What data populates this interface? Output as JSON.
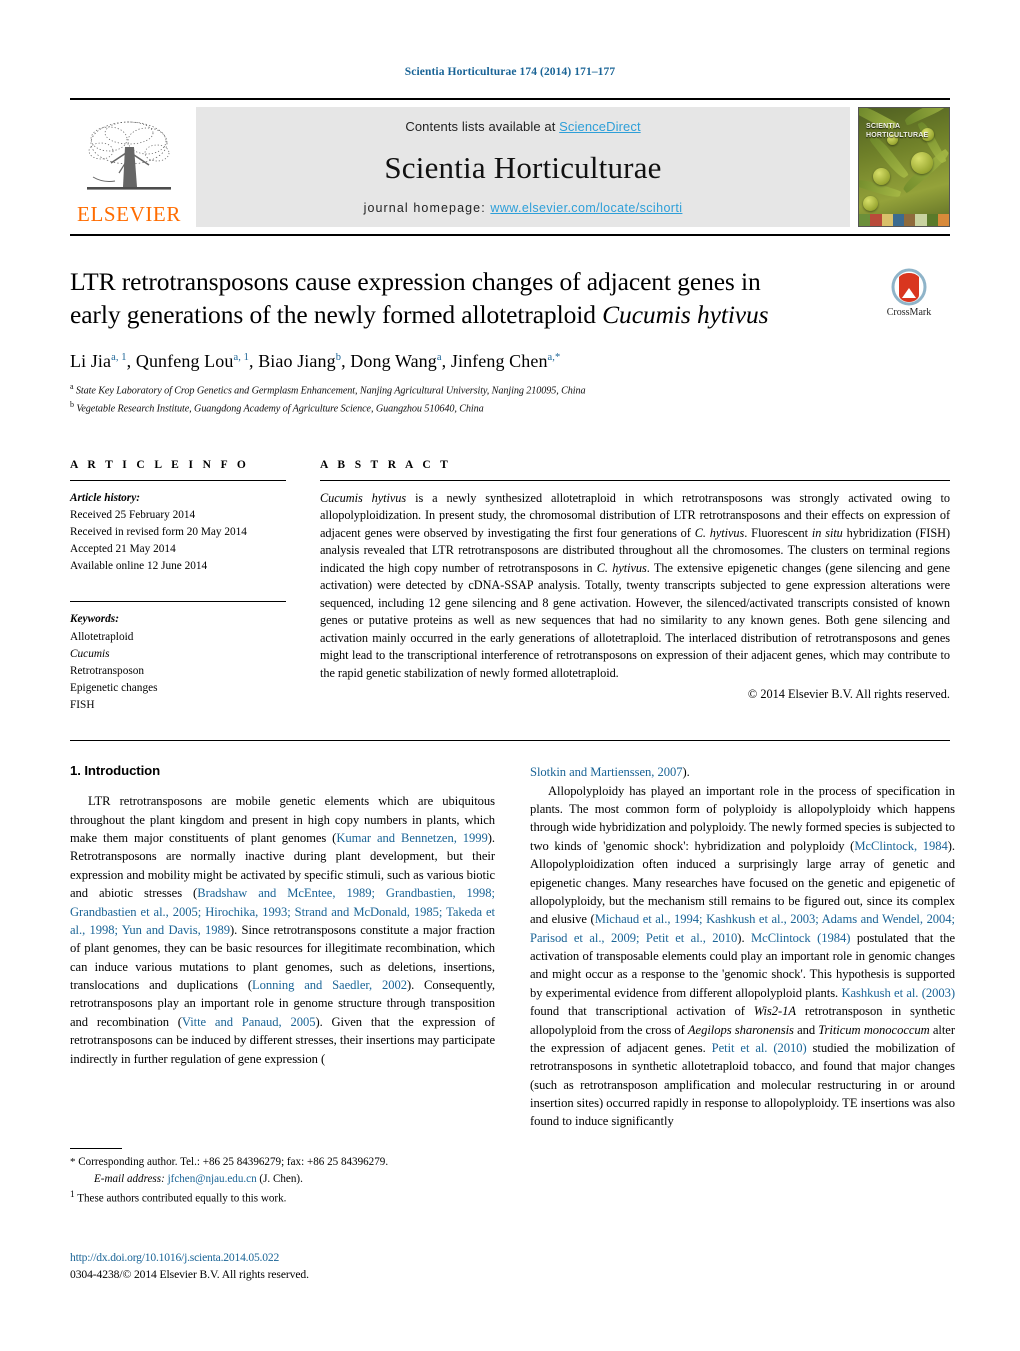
{
  "running_head": "Scientia Horticulturae 174 (2014) 171–177",
  "masthead": {
    "contents_prefix": "Contents lists available at ",
    "contents_link": "ScienceDirect",
    "journal_title": "Scientia Horticulturae",
    "homepage_prefix": "journal homepage: ",
    "homepage_url": "www.elsevier.com/locate/scihorti",
    "publisher_wordmark": "ELSEVIER",
    "publisher_logo_icon": "elsevier-tree-icon",
    "cover_title_line1": "SCIENTIA",
    "cover_title_line2": "HORTICULTURAE",
    "accent_link_color": "#2e9fd8",
    "publisher_orange": "#ff6c00"
  },
  "title_block": {
    "title_line1": "LTR retrotransposons cause expression changes of adjacent genes in",
    "title_line2_pre": "early generations of the newly formed allotetraploid ",
    "title_line2_italic": "Cucumis hytivus",
    "crossmark_label": "CrossMark",
    "crossmark_icon": "crossmark-icon",
    "authors": [
      {
        "name": "Li Jia",
        "sup": "a, 1",
        "sep": ", "
      },
      {
        "name": "Qunfeng Lou",
        "sup": "a, 1",
        "sep": ", "
      },
      {
        "name": "Biao Jiang",
        "sup": "b",
        "sep": ", "
      },
      {
        "name": "Dong Wang",
        "sup": "a",
        "sep": ", "
      },
      {
        "name": "Jinfeng Chen",
        "sup": "a,*",
        "sep": ""
      }
    ],
    "affiliation_a_marker": "a",
    "affiliation_a": "State Key Laboratory of Crop Genetics and Germplasm Enhancement, Nanjing Agricultural University, Nanjing 210095, China",
    "affiliation_b_marker": "b",
    "affiliation_b": "Vegetable Research Institute, Guangdong Academy of Agriculture Science, Guangzhou 510640, China"
  },
  "article_info": {
    "heading": "A R T I C L E   I N F O",
    "history_label": "Article history:",
    "history": [
      "Received 25 February 2014",
      "Received in revised form 20 May 2014",
      "Accepted 21 May 2014",
      "Available online 12 June 2014"
    ],
    "keywords_label": "Keywords:",
    "keywords": [
      "Allotetraploid",
      "Cucumis",
      "Retrotransposon",
      "Epigenetic changes",
      "FISH"
    ],
    "keyword_italic_index": 1
  },
  "abstract": {
    "heading": "A B S T R A C T",
    "lead_italic": "Cucumis hytivus",
    "text_part1": " is a newly synthesized allotetraploid in which retrotransposons was strongly activated owing to allopolyploidization. In present study, the chromosomal distribution of LTR retrotransposons and their effects on expression of adjacent genes were observed by investigating the first four generations of ",
    "italic1": "C. hytivus",
    "text_part2": ". Fluorescent ",
    "italic2": "in situ",
    "text_part3": " hybridization (FISH) analysis revealed that LTR retrotransposons are distributed throughout all the chromosomes. The clusters on terminal regions indicated the high copy number of retrotransposons in ",
    "italic3": "C. hytivus",
    "text_part4": ". The extensive epigenetic changes (gene silencing and gene activation) were detected by cDNA-SSAP analysis. Totally, twenty transcripts subjected to gene expression alterations were sequenced, including 12 gene silencing and 8 gene activation. However, the silenced/activated transcripts consisted of known genes or putative proteins as well as new sequences that had no similarity to any known genes. Both gene silencing and activation mainly occurred in the early generations of allotetraploid. The interlaced distribution of retrotransposons and genes might lead to the transcriptional interference of retrotransposons on expression of their adjacent genes, which may contribute to the rapid genetic stabilization of newly formed allotetraploid.",
    "copyright": "© 2014 Elsevier B.V. All rights reserved."
  },
  "introduction": {
    "heading": "1.  Introduction",
    "left_p1_a": "LTR retrotransposons are mobile genetic elements which are ubiquitous throughout the plant kingdom and present in high copy numbers in plants, which make them major constituents of plant genomes (",
    "ref1": "Kumar and Bennetzen, 1999",
    "left_p1_b": "). Retrotransposons are normally inactive during plant development, but their expression and mobility might be activated by specific stimuli, such as various biotic and abiotic stresses (",
    "ref2": "Bradshaw and McEntee, 1989; Grandbastien, 1998; Grandbastien et al., 2005; Hirochika, 1993; Strand and McDonald, 1985; Takeda et al., 1998; Yun and Davis, 1989",
    "left_p1_c": "). Since retrotransposons constitute a major fraction of plant genomes, they can be basic resources for illegitimate recombination, which can induce various mutations to plant genomes, such as deletions, insertions, translocations and duplications (",
    "ref3": "Lonning and Saedler, 2002",
    "left_p1_d": "). Consequently, retrotransposons play an important role in genome structure through transposition and recombination (",
    "ref4": "Vitte and Panaud, 2005",
    "left_p1_e": "). Given that the expression of retrotransposons can be induced by different stresses, their insertions may participate indirectly in further regulation of gene expression (",
    "ref5": "Slotkin and Martienssen, 2007",
    "left_p1_f": ").",
    "right_p2_a": "Allopolyploidy has played an important role in the process of specification in plants. The most common form of polyploidy is allopolyploidy which happens through wide hybridization and polyploidy. The newly formed species is subjected to two kinds of 'genomic shock': hybridization and polyploidy (",
    "ref6": "McClintock, 1984",
    "right_p2_b": "). Allopolyploidization often induced a surprisingly large array of genetic and epigenetic changes. Many researches have focused on the genetic and epigenetic of allopolyploidy, but the mechanism still remains to be figured out, since its complex and elusive (",
    "ref7": "Michaud et al., 1994; Kashkush et al., 2003; Adams and Wendel, 2004; Parisod et al., 2009; Petit et al., 2010",
    "right_p2_c": "). ",
    "ref8": "McClintock (1984)",
    "right_p2_d": " postulated that the activation of transposable elements could play an important role in genomic changes and might occur as a response to the 'genomic shock'. This hypothesis is supported by experimental evidence from different allopolyploid plants. ",
    "ref9": "Kashkush et al. (2003)",
    "right_p2_e": " found that transcriptional activation of ",
    "italic_a": "Wis2-1A",
    "right_p2_f": " retrotransposon in synthetic allopolyploid from the cross of ",
    "italic_b": "Aegilops sharonensis",
    "right_p2_g": " and ",
    "italic_c": "Triticum monococcum",
    "right_p2_h": " alter the expression of adjacent genes. ",
    "ref10": "Petit et al. (2010)",
    "right_p2_i": " studied the mobilization of retrotransposons in synthetic allotetraploid tobacco, and found that major changes (such as retrotransposon amplification and molecular restructuring in or around insertion sites) occurred rapidly in response to allopolyploidy. TE insertions was also found to induce significantly"
  },
  "footnotes": {
    "corresponding_marker": "*",
    "corresponding_text": "Corresponding author. Tel.: +86 25 84396279; fax: +86 25 84396279.",
    "email_label": "E-mail address:",
    "email": "jfchen@njau.edu.cn",
    "email_suffix": "(J. Chen).",
    "equal_marker": "1",
    "equal_text": "These authors contributed equally to this work.",
    "doi": "http://dx.doi.org/10.1016/j.scienta.2014.05.022",
    "issn_line": "0304-4238/© 2014 Elsevier B.V. All rights reserved."
  }
}
